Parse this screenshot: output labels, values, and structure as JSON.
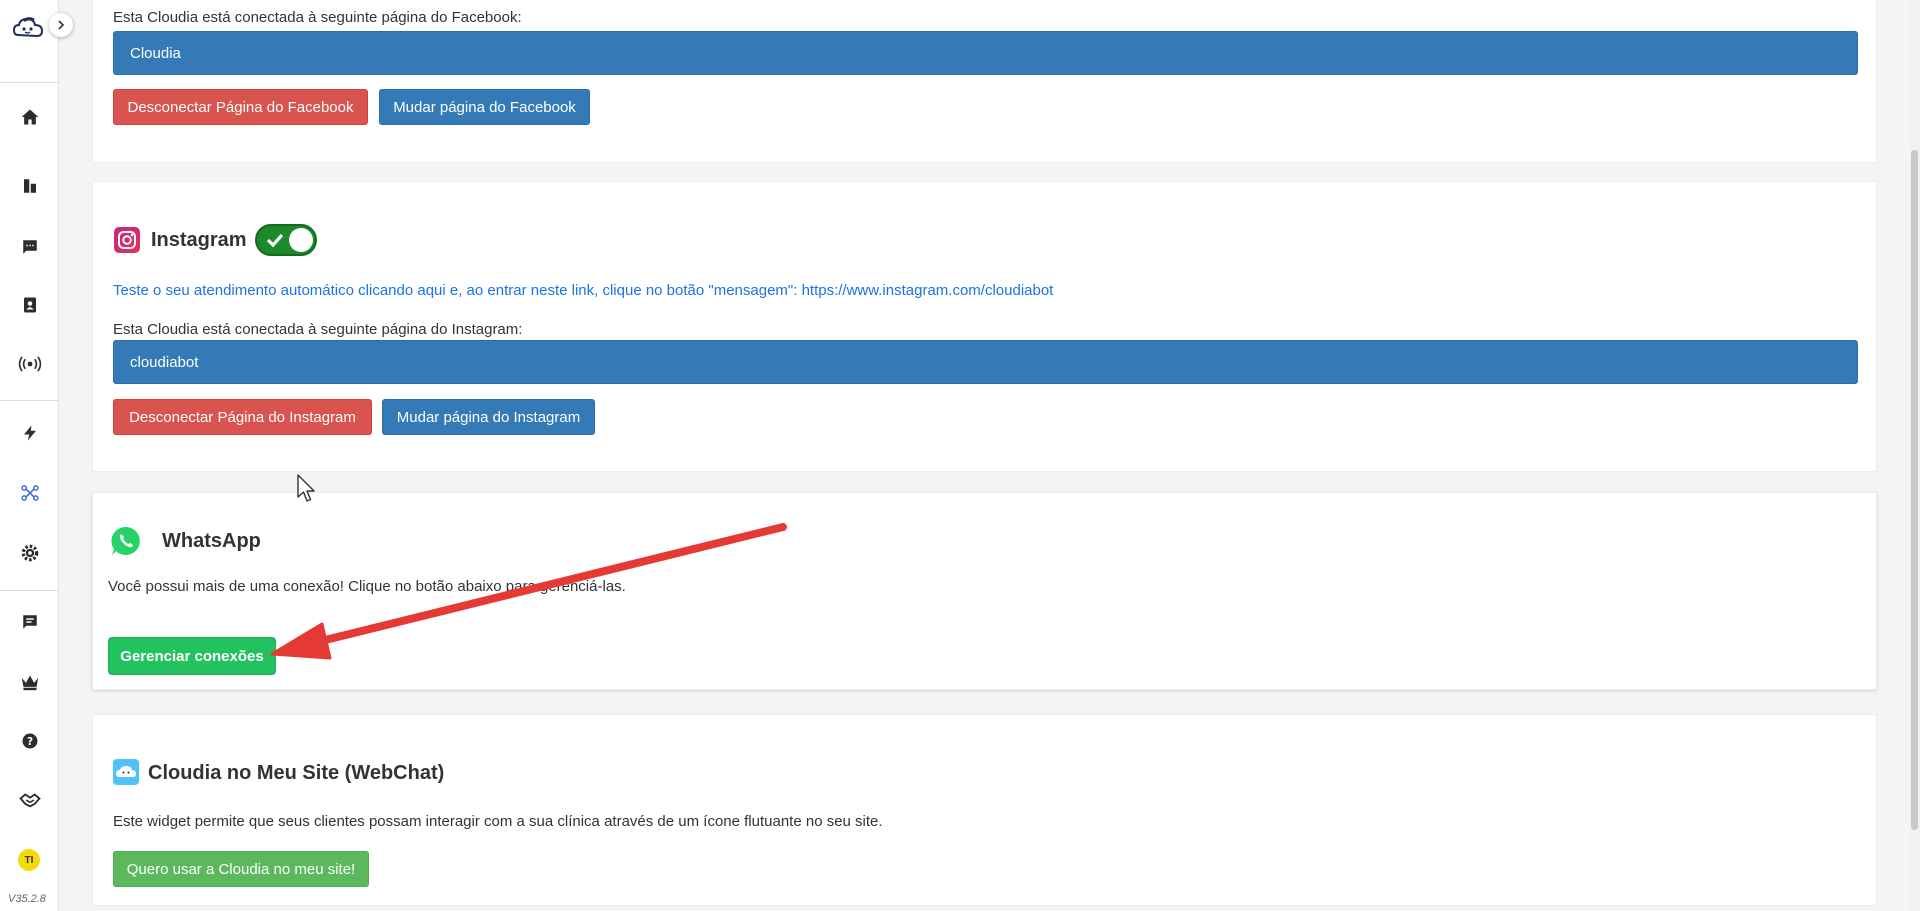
{
  "sidebar": {
    "version": "V35.2.8",
    "avatar_initials": "TI",
    "items": [
      {
        "name": "home-icon"
      },
      {
        "name": "dashboard-icon"
      },
      {
        "name": "chat-icon"
      },
      {
        "name": "contacts-icon"
      },
      {
        "name": "broadcast-icon"
      },
      {
        "name": "automation-icon"
      },
      {
        "name": "integrations-icon"
      },
      {
        "name": "settings-icon"
      },
      {
        "name": "messages-icon"
      },
      {
        "name": "premium-crown-icon"
      },
      {
        "name": "help-icon"
      },
      {
        "name": "partners-icon"
      }
    ]
  },
  "facebook": {
    "connected_label": "Esta Cloudia está conectada à seguinte página do Facebook:",
    "page_name": "Cloudia",
    "disconnect_label": "Desconectar Página do Facebook",
    "change_label": "Mudar página do Facebook"
  },
  "instagram": {
    "title": "Instagram",
    "enabled": true,
    "test_link_text": "Teste o seu atendimento automático clicando aqui e, ao entrar neste link, clique no botão \"mensagem\": https://www.instagram.com/cloudiabot",
    "connected_label": "Esta Cloudia está conectada à seguinte página do Instagram:",
    "page_name": "cloudiabot",
    "disconnect_label": "Desconectar Página do Instagram",
    "change_label": "Mudar página do Instagram"
  },
  "whatsapp": {
    "title": "WhatsApp",
    "description": "Você possui mais de uma conexão! Clique no botão abaixo para gerenciá-las.",
    "manage_label": "Gerenciar conexões"
  },
  "webchat": {
    "title": "Cloudia no Meu Site (WebChat)",
    "description": "Este widget permite que seus clientes possam interagir com a sua clínica através de um ícone flutuante no seu site.",
    "cta_label": "Quero usar a Cloudia no meu site!"
  },
  "colors": {
    "primary": "#337ab7",
    "danger": "#d9534f",
    "success": "#22c35e",
    "link": "#1a73e8",
    "annotation_arrow": "#e53935"
  }
}
